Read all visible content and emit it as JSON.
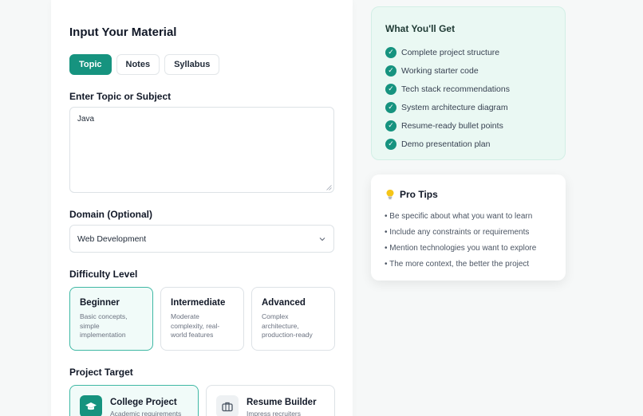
{
  "form": {
    "title": "Input Your Material",
    "tabs": [
      {
        "label": "Topic",
        "active": true
      },
      {
        "label": "Notes",
        "active": false
      },
      {
        "label": "Syllabus",
        "active": false
      }
    ],
    "topic_label": "Enter Topic or Subject",
    "topic_value": "Java",
    "domain_label": "Domain (Optional)",
    "domain_value": "Web Development",
    "difficulty_label": "Difficulty Level",
    "difficulty": [
      {
        "title": "Beginner",
        "desc": "Basic concepts, simple implementation",
        "active": true
      },
      {
        "title": "Intermediate",
        "desc": "Moderate complexity, real-world features",
        "active": false
      },
      {
        "title": "Advanced",
        "desc": "Complex architecture, production-ready",
        "active": false
      }
    ],
    "target_label": "Project Target",
    "targets": [
      {
        "title": "College Project",
        "desc": "Academic requirements",
        "icon": "graduation-cap-icon",
        "active": true
      },
      {
        "title": "Resume Builder",
        "desc": "Impress recruiters",
        "icon": "briefcase-icon",
        "active": false
      }
    ]
  },
  "benefits": {
    "title": "What You'll Get",
    "items": [
      "Complete project structure",
      "Working starter code",
      "Tech stack recommendations",
      "System architecture diagram",
      "Resume-ready bullet points",
      "Demo presentation plan"
    ]
  },
  "tips": {
    "title": "Pro Tips",
    "icon": "lightbulb-icon",
    "items": [
      "• Be specific about what you want to learn",
      "• Include any constraints or requirements",
      "• Mention technologies you want to explore",
      "• The more context, the better the project"
    ]
  },
  "colors": {
    "accent": "#16937f",
    "accent_border": "#3fb8a4",
    "benefits_bg": "#eaf8f3"
  }
}
